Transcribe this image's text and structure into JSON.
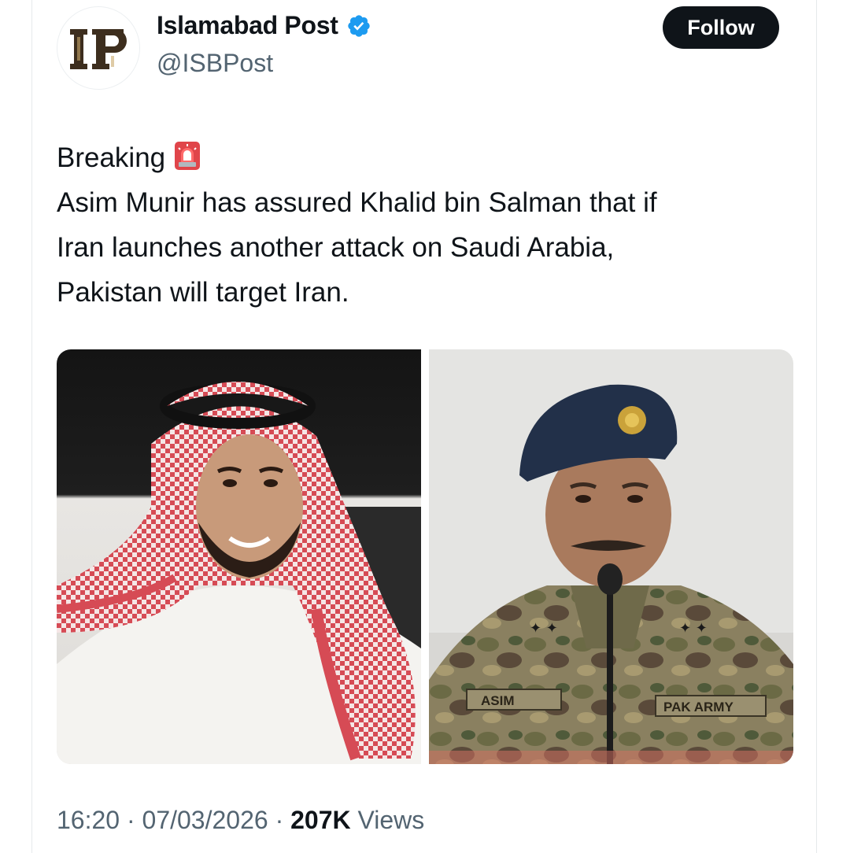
{
  "account": {
    "avatar_initials": "IP",
    "display_name": "Islamabad Post",
    "handle": "@ISBPost",
    "verified": true,
    "verified_color": "#1d9bf0"
  },
  "follow_button": {
    "label": "Follow"
  },
  "tweet": {
    "lines": [
      "Breaking",
      "Asim Munir has assured Khalid bin Salman that if",
      "Iran launches another attack on Saudi Arabia,",
      "Pakistan will target Iran."
    ],
    "emoji_icon": "police-siren-icon"
  },
  "media": {
    "left_image": {
      "subject": "man in red-and-white keffiyeh"
    },
    "right_image": {
      "subject": "general in camouflage uniform and beret speaking at microphone",
      "patch_left": "ASIM",
      "patch_right": "PAK ARMY"
    }
  },
  "footer": {
    "time": "16:20",
    "separator": "·",
    "date": "07/03/2026",
    "views_count": "207K",
    "views_label": "Views"
  },
  "colors": {
    "text_primary": "#0f1419",
    "text_secondary": "#536471",
    "follow_bg": "#0f1419",
    "follow_text": "#ffffff"
  }
}
